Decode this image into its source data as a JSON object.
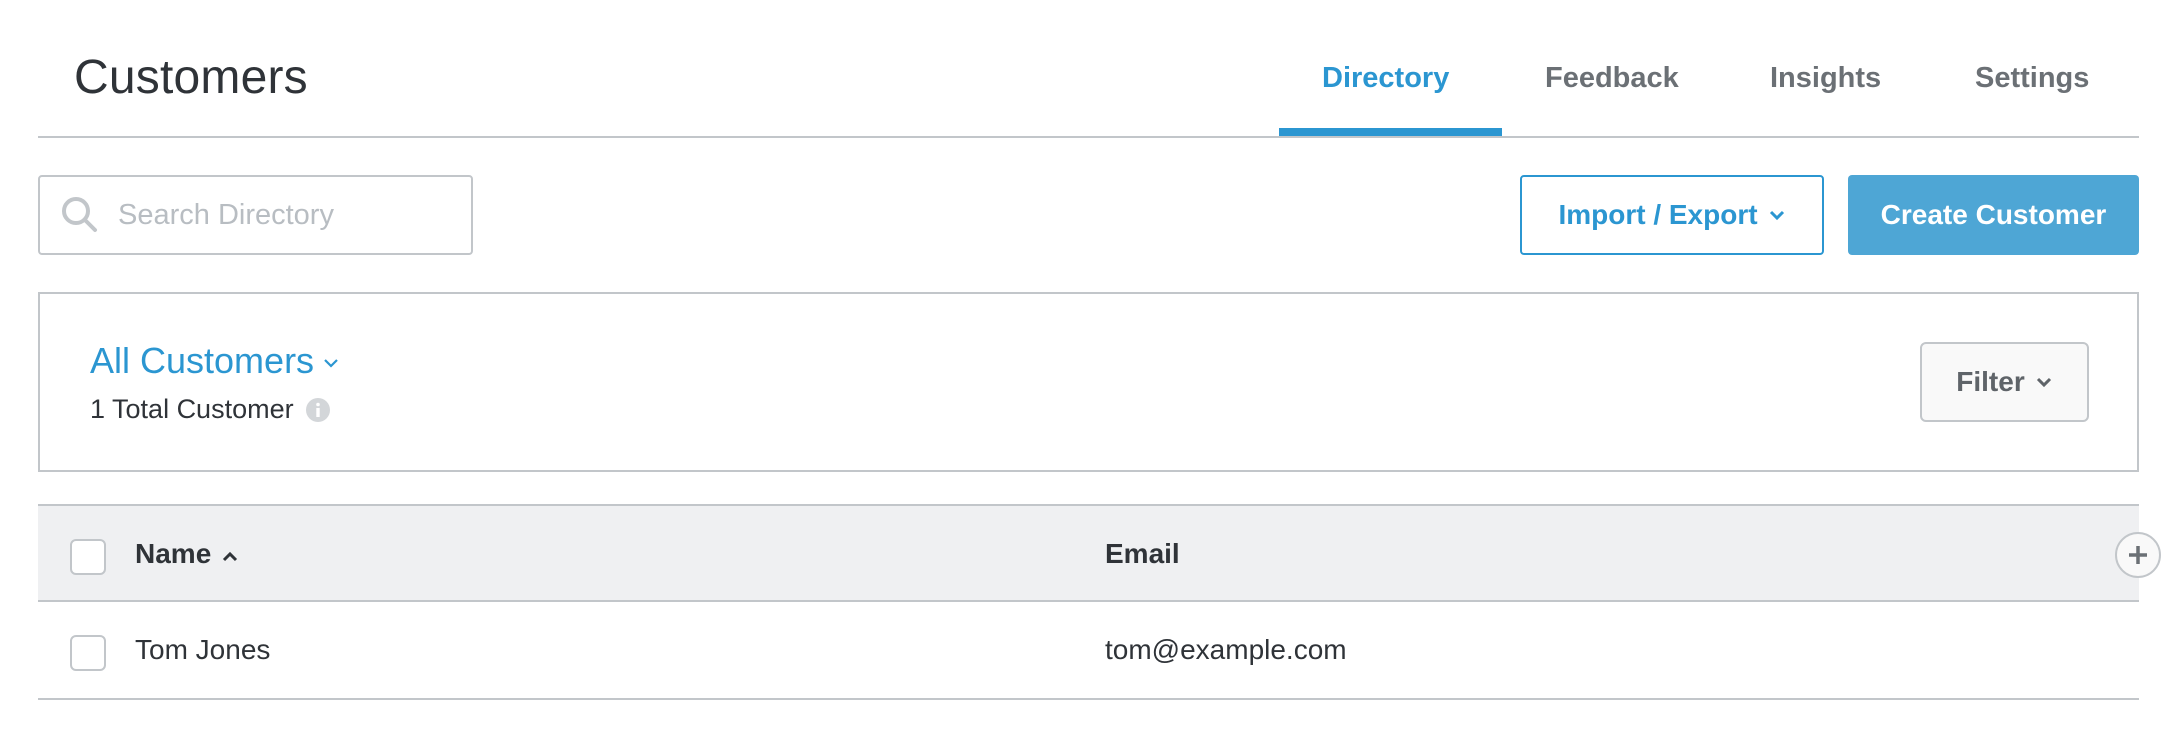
{
  "header": {
    "title": "Customers",
    "tabs": [
      {
        "label": "Directory",
        "active": true
      },
      {
        "label": "Feedback",
        "active": false
      },
      {
        "label": "Insights",
        "active": false
      },
      {
        "label": "Settings",
        "active": false
      }
    ]
  },
  "toolbar": {
    "search": {
      "placeholder": "Search Directory",
      "value": "",
      "icon": "search-icon"
    },
    "import_export_label": "Import / Export",
    "create_label": "Create Customer"
  },
  "segment": {
    "title": "All Customers",
    "count_text": "1 Total Customer",
    "filter_label": "Filter"
  },
  "table": {
    "columns": [
      {
        "label": "Name",
        "sort": "ascending"
      },
      {
        "label": "Email"
      }
    ],
    "rows": [
      {
        "name": "Tom Jones",
        "email": "tom@example.com",
        "selected": false
      }
    ]
  },
  "colors": {
    "accent": "#2b96d1",
    "primary_button": "#4ea6d5",
    "border": "#c2c6ca",
    "table_header_bg": "#eff0f2"
  }
}
